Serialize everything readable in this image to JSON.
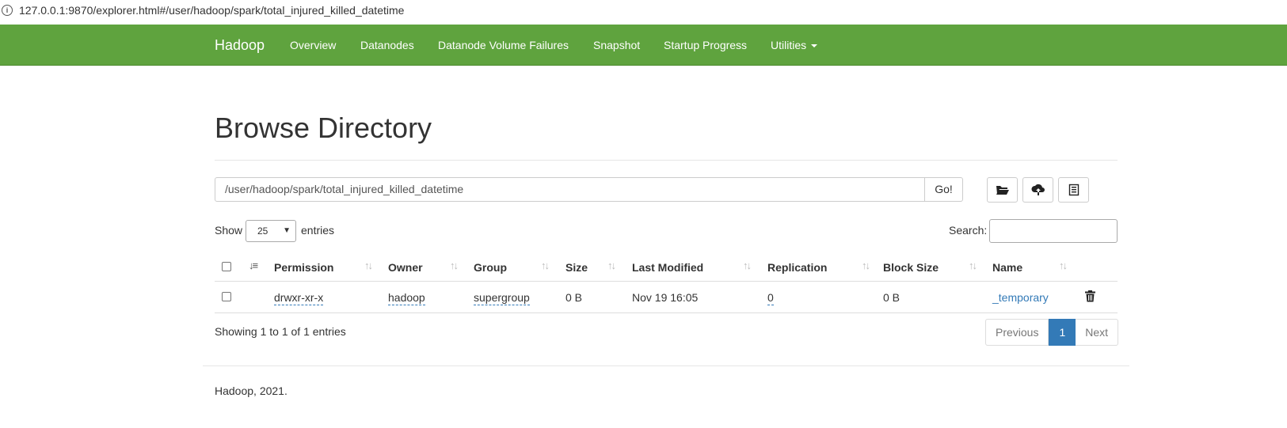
{
  "browser": {
    "url": "127.0.0.1:9870/explorer.html#/user/hadoop/spark/total_injured_killed_datetime"
  },
  "navbar": {
    "brand": "Hadoop",
    "items": [
      {
        "label": "Overview"
      },
      {
        "label": "Datanodes"
      },
      {
        "label": "Datanode Volume Failures"
      },
      {
        "label": "Snapshot"
      },
      {
        "label": "Startup Progress"
      },
      {
        "label": "Utilities"
      }
    ],
    "background_color": "#5fa33e"
  },
  "page": {
    "title": "Browse Directory",
    "path_value": "/user/hadoop/spark/total_injured_killed_datetime",
    "go_label": "Go!",
    "toolbar_icons": [
      "folder-open-icon",
      "upload-icon",
      "clipboard-icon"
    ]
  },
  "table_controls": {
    "show_label": "Show",
    "page_size": "25",
    "entries_label": "entries",
    "search_label": "Search:",
    "search_value": ""
  },
  "table": {
    "headers": [
      "Permission",
      "Owner",
      "Group",
      "Size",
      "Last Modified",
      "Replication",
      "Block Size",
      "Name"
    ],
    "rows": [
      {
        "permission": "drwxr-xr-x",
        "owner": "hadoop",
        "group": "supergroup",
        "size": "0 B",
        "last_modified": "Nov 19 16:05",
        "replication": "0",
        "block_size": "0 B",
        "name": "_temporary"
      }
    ],
    "info": "Showing 1 to 1 of 1 entries"
  },
  "pagination": {
    "previous": "Previous",
    "current": "1",
    "next": "Next",
    "active_color": "#337ab7"
  },
  "footer": {
    "text": "Hadoop, 2021."
  }
}
